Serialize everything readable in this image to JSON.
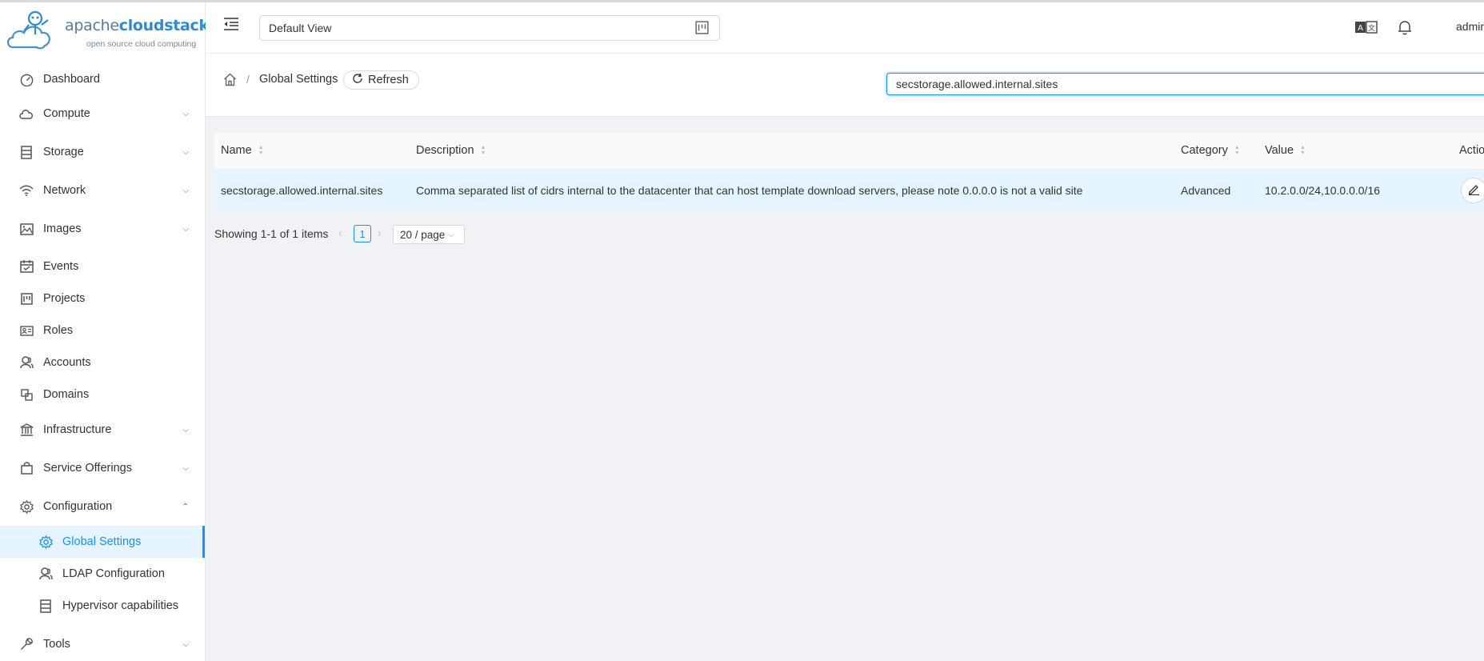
{
  "logo": {
    "part1": "apache",
    "part2": "cloudstack",
    "tagline": "open source cloud computing"
  },
  "header": {
    "view": "Default View",
    "user": "admin"
  },
  "sidebar": {
    "items": [
      {
        "label": "Dashboard",
        "icon": "dashboard-icon"
      },
      {
        "label": "Compute",
        "icon": "cloud-icon"
      },
      {
        "label": "Storage",
        "icon": "storage-icon"
      },
      {
        "label": "Network",
        "icon": "wifi-icon"
      },
      {
        "label": "Images",
        "icon": "picture-icon"
      },
      {
        "label": "Events",
        "icon": "schedule-icon"
      },
      {
        "label": "Projects",
        "icon": "project-icon"
      },
      {
        "label": "Roles",
        "icon": "idcard-icon"
      },
      {
        "label": "Accounts",
        "icon": "team-icon"
      },
      {
        "label": "Domains",
        "icon": "block-icon"
      },
      {
        "label": "Infrastructure",
        "icon": "bank-icon"
      },
      {
        "label": "Service Offerings",
        "icon": "shopping-icon"
      },
      {
        "label": "Configuration",
        "icon": "setting-icon"
      },
      {
        "label": "Global Settings",
        "icon": "setting-icon"
      },
      {
        "label": "LDAP Configuration",
        "icon": "team-icon"
      },
      {
        "label": "Hypervisor capabilities",
        "icon": "database-icon"
      },
      {
        "label": "Tools",
        "icon": "tool-icon"
      }
    ]
  },
  "breadcrumb": {
    "current": "Global Settings",
    "separator": "/"
  },
  "toolbar": {
    "refresh": "Refresh",
    "search_value": "secstorage.allowed.internal.sites"
  },
  "table": {
    "columns": [
      "Name",
      "Description",
      "Category",
      "Value",
      "Actio"
    ],
    "rows": [
      {
        "name": "secstorage.allowed.internal.sites",
        "description": "Comma separated list of cidrs internal to the datacenter that can host template download servers, please note 0.0.0.0 is not a valid site",
        "category": "Advanced",
        "value": "10.2.0.0/24,10.0.0.0/16"
      }
    ]
  },
  "pagination": {
    "total": "Showing 1-1 of 1 items",
    "page": "1",
    "page_size": "20 / page"
  },
  "colors": {
    "accent": "#1890ff",
    "selected_row": "#e6f4ff"
  }
}
